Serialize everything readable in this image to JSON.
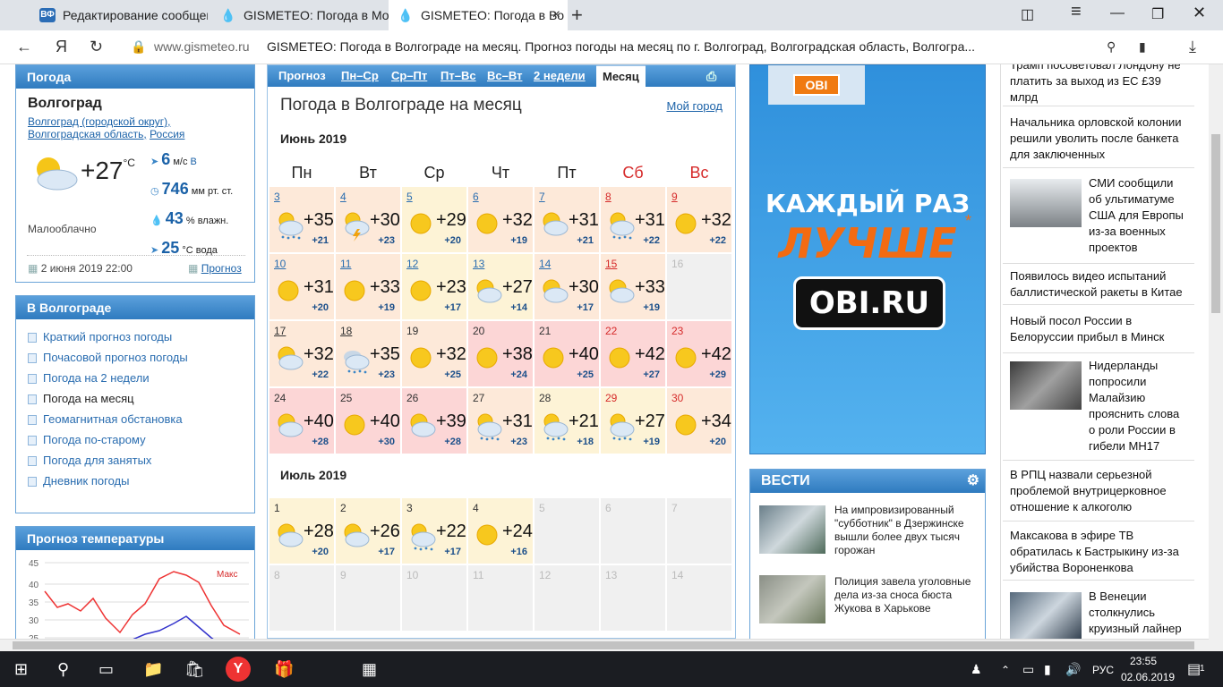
{
  "browser": {
    "tabs": [
      {
        "label": "Редактирование сообщени",
        "favicon": "ВФ"
      },
      {
        "label": "GISMETEO: Погода в Моск",
        "favicon": ""
      },
      {
        "label": "GISMETEO: Погода в Во",
        "favicon": ""
      }
    ],
    "yandex_btn": "Я",
    "url_domain": "www.gismeteo.ru",
    "page_title": "GISMETEO: Погода в Волгограде на месяц. Прогноз погоды на месяц по г. Волгоград, Волгоградская область, Волгогра..."
  },
  "left": {
    "weather_header": "Погода",
    "city": "Волгоград",
    "breadcrumb": [
      "Волгоград (городской округ),",
      "Волгоградская область,",
      "Россия"
    ],
    "temp": "+27",
    "temp_unit": "°C",
    "wind_val": "6",
    "wind_unit": "м/с",
    "wind_dir": "В",
    "pressure_val": "746",
    "pressure_unit": "мм рт. ст.",
    "humidity_val": "43",
    "humidity_unit": "% влажн.",
    "water_val": "25",
    "water_unit": "°С вода",
    "condition": "Малооблачно",
    "datetime": "2 июня 2019 22:00",
    "forecast_link": "Прогноз",
    "city_menu_header": "В Волгограде",
    "menu": [
      "Краткий прогноз погоды",
      "Почасовой прогноз погоды",
      "Погода на 2 недели",
      "Погода на месяц",
      "Геомагнитная обстановка",
      "Погода по-старому",
      "Погода для занятых",
      "Дневник погоды"
    ],
    "menu_current": 3,
    "temp_forecast_header": "Прогноз температуры",
    "chart_max_label": "Макс",
    "chart_yticks": [
      "45",
      "40",
      "35",
      "30",
      "25"
    ]
  },
  "forecast": {
    "tabs": {
      "prognoz": "Прогноз",
      "t1": "Пн–Ср",
      "t2": "Ср–Пт",
      "t3": "Пт–Вс",
      "t4": "Вс–Вт",
      "t5": "2 недели",
      "t6": "Месяц"
    },
    "title": "Погода в Волгограде на месяц",
    "my_city": "Мой город",
    "june_label": "Июнь 2019",
    "july_label": "Июль 2019",
    "weekdays": [
      "Пн",
      "Вт",
      "Ср",
      "Чт",
      "Пт",
      "Сб",
      "Вс"
    ],
    "june": [
      {
        "d": "3",
        "hi": "+35",
        "lo": "+21",
        "ic": "rain-cloud"
      },
      {
        "d": "4",
        "hi": "+30",
        "lo": "+23",
        "ic": "storm"
      },
      {
        "d": "5",
        "hi": "+29",
        "lo": "+20",
        "ic": "sun"
      },
      {
        "d": "6",
        "hi": "+32",
        "lo": "+19",
        "ic": "sun"
      },
      {
        "d": "7",
        "hi": "+31",
        "lo": "+21",
        "ic": "partly"
      },
      {
        "d": "8",
        "hi": "+31",
        "lo": "+22",
        "ic": "rain-cloud"
      },
      {
        "d": "9",
        "hi": "+32",
        "lo": "+22",
        "ic": "sun"
      },
      {
        "d": "10",
        "hi": "+31",
        "lo": "+20",
        "ic": "sun"
      },
      {
        "d": "11",
        "hi": "+33",
        "lo": "+19",
        "ic": "sun"
      },
      {
        "d": "12",
        "hi": "+23",
        "lo": "+17",
        "ic": "sun"
      },
      {
        "d": "13",
        "hi": "+27",
        "lo": "+14",
        "ic": "partly"
      },
      {
        "d": "14",
        "hi": "+30",
        "lo": "+17",
        "ic": "partly"
      },
      {
        "d": "15",
        "hi": "+33",
        "lo": "+19",
        "ic": "partly"
      },
      {
        "d": "16",
        "hi": "",
        "lo": "",
        "ic": ""
      },
      {
        "d": "17",
        "hi": "+32",
        "lo": "+22",
        "ic": "partly"
      },
      {
        "d": "18",
        "hi": "+35",
        "lo": "+23",
        "ic": "cloudy"
      },
      {
        "d": "19",
        "hi": "+32",
        "lo": "+25",
        "ic": "sun"
      },
      {
        "d": "20",
        "hi": "+38",
        "lo": "+24",
        "ic": "sun"
      },
      {
        "d": "21",
        "hi": "+40",
        "lo": "+25",
        "ic": "sun"
      },
      {
        "d": "22",
        "hi": "+42",
        "lo": "+27",
        "ic": "sun"
      },
      {
        "d": "23",
        "hi": "+42",
        "lo": "+29",
        "ic": "sun"
      },
      {
        "d": "24",
        "hi": "+40",
        "lo": "+28",
        "ic": "partly"
      },
      {
        "d": "25",
        "hi": "+40",
        "lo": "+30",
        "ic": "sun"
      },
      {
        "d": "26",
        "hi": "+39",
        "lo": "+28",
        "ic": "partly"
      },
      {
        "d": "27",
        "hi": "+31",
        "lo": "+23",
        "ic": "rain-cloud"
      },
      {
        "d": "28",
        "hi": "+21",
        "lo": "+18",
        "ic": "rain-cloud"
      },
      {
        "d": "29",
        "hi": "+27",
        "lo": "+19",
        "ic": "rain-cloud"
      },
      {
        "d": "30",
        "hi": "+34",
        "lo": "+20",
        "ic": "sun"
      }
    ],
    "july": [
      {
        "d": "1",
        "hi": "+28",
        "lo": "+20",
        "ic": "partly"
      },
      {
        "d": "2",
        "hi": "+26",
        "lo": "+17",
        "ic": "partly"
      },
      {
        "d": "3",
        "hi": "+22",
        "lo": "+17",
        "ic": "rain-cloud"
      },
      {
        "d": "4",
        "hi": "+24",
        "lo": "+16",
        "ic": "sun"
      },
      {
        "d": "5",
        "hi": "",
        "lo": "",
        "ic": ""
      },
      {
        "d": "6",
        "hi": "",
        "lo": "",
        "ic": ""
      },
      {
        "d": "7",
        "hi": "",
        "lo": "",
        "ic": ""
      },
      {
        "d": "8",
        "hi": "",
        "lo": "",
        "ic": ""
      },
      {
        "d": "9",
        "hi": "",
        "lo": "",
        "ic": ""
      },
      {
        "d": "10",
        "hi": "",
        "lo": "",
        "ic": ""
      },
      {
        "d": "11",
        "hi": "",
        "lo": "",
        "ic": ""
      },
      {
        "d": "12",
        "hi": "",
        "lo": "",
        "ic": ""
      },
      {
        "d": "13",
        "hi": "",
        "lo": "",
        "ic": ""
      },
      {
        "d": "14",
        "hi": "",
        "lo": "",
        "ic": ""
      }
    ]
  },
  "ad": {
    "logo_top": "OBI",
    "line1": "КАЖДЫЙ РАЗ",
    "line2": "ЛУЧШЕ",
    "star": "*",
    "site": "OBI.RU"
  },
  "vesti": {
    "header": "ВЕСТИ",
    "items": [
      "На импровизированный \"субботник\" в Дзержинске вышли более двух тысяч горожан",
      "Полиция завела уголовные дела из-за сноса бюста Жукова в Харькове"
    ]
  },
  "news": [
    "Трамп посоветовал Лондону не платить за выход из ЕС £39 млрд",
    "Начальника орловской колонии решили уволить после банкета для заключенных",
    "СМИ сообщили об ультиматуме США для Европы из-за военных проектов",
    "Появилось видео испытаний баллистической ракеты в Китае",
    "Новый посол России в Белоруссии прибыл в Минск",
    "Нидерланды попросили Малайзию прояснить слова о роли России в гибели MH17",
    "В РПЦ назвали серьезной проблемой внутрицерковное отношение к алкоголю",
    "Максакова в эфире ТВ обратилась к Бастрыкину из-за убийства Вороненкова",
    "В Венеции столкнулись круизный лайнер"
  ],
  "taskbar": {
    "lang": "РУС",
    "time": "23:55",
    "date": "02.06.2019",
    "notif": "1"
  },
  "colors": {
    "header_blue": "#3b86c7",
    "warm_cell": "#fde9d9",
    "hot_cell": "#fcd6d6",
    "mild_cell": "#fdf3d6",
    "weekend_red": "#d62b2b"
  }
}
